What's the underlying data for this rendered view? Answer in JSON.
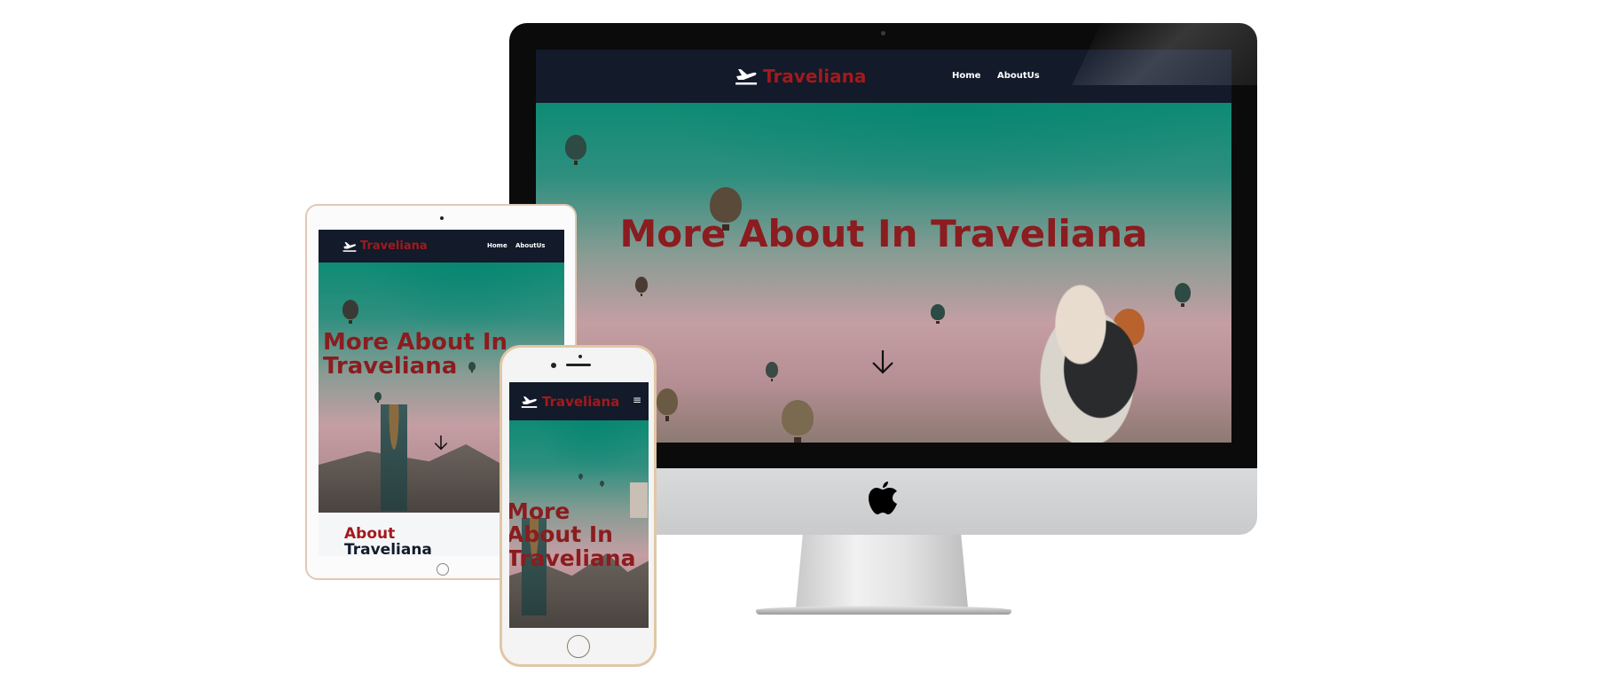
{
  "site": {
    "brand_name": "Traveliana",
    "nav": {
      "home_label": "Home",
      "about_label": "AboutUs"
    },
    "hero": {
      "title": "More About In Traveliana"
    },
    "about": {
      "line1": "About",
      "line2": "Traveliana"
    }
  },
  "icons": {
    "brand": "plane-departure-icon",
    "scroll": "arrow-down-icon",
    "menu": "hamburger-menu-icon",
    "device_logo": "apple-icon"
  },
  "colors": {
    "nav_background": "#131a2a",
    "brand": "#a3191c",
    "hero_title": "#8b1c1f",
    "page_background": "#ffffff"
  },
  "menu_glyph": "≡"
}
